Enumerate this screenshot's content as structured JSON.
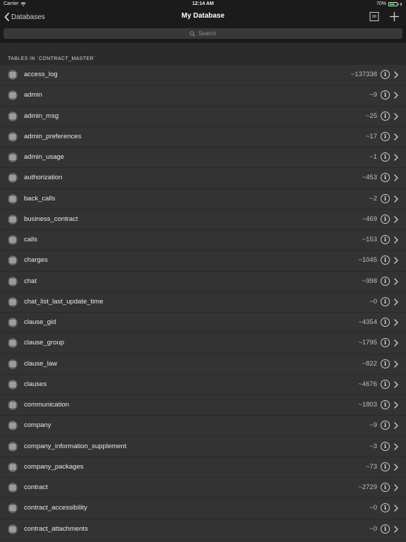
{
  "status": {
    "carrier": "Carrier",
    "time": "12:14 AM",
    "battery": "70%",
    "battery_level": 0.7
  },
  "nav": {
    "back_label": "Databases",
    "title": "My Database",
    "doc_icon": "document-icon",
    "add_icon": "plus-icon"
  },
  "search": {
    "placeholder": "Search"
  },
  "section": {
    "header": "TABLES IN `CONTRACT_MASTER`"
  },
  "tables": [
    {
      "name": "access_log",
      "count": "~137338"
    },
    {
      "name": "admin",
      "count": "~9"
    },
    {
      "name": "admin_msg",
      "count": "~25"
    },
    {
      "name": "admin_preferences",
      "count": "~17"
    },
    {
      "name": "admin_usage",
      "count": "~1"
    },
    {
      "name": "authorization",
      "count": "~453"
    },
    {
      "name": "back_calls",
      "count": "~2"
    },
    {
      "name": "business_contract",
      "count": "~469"
    },
    {
      "name": "calls",
      "count": "~153"
    },
    {
      "name": "charges",
      "count": "~1045"
    },
    {
      "name": "chat",
      "count": "~998"
    },
    {
      "name": "chat_list_last_update_time",
      "count": "~0"
    },
    {
      "name": "clause_gid",
      "count": "~4354"
    },
    {
      "name": "clause_group",
      "count": "~1795"
    },
    {
      "name": "clause_law",
      "count": "~822"
    },
    {
      "name": "clauses",
      "count": "~4676"
    },
    {
      "name": "communication",
      "count": "~1803"
    },
    {
      "name": "company",
      "count": "~9"
    },
    {
      "name": "company_information_supplement",
      "count": "~3"
    },
    {
      "name": "company_packages",
      "count": "~73"
    },
    {
      "name": "contract",
      "count": "~2729"
    },
    {
      "name": "contract_accessibility",
      "count": "~0"
    },
    {
      "name": "contract_attachments",
      "count": "~0"
    }
  ]
}
